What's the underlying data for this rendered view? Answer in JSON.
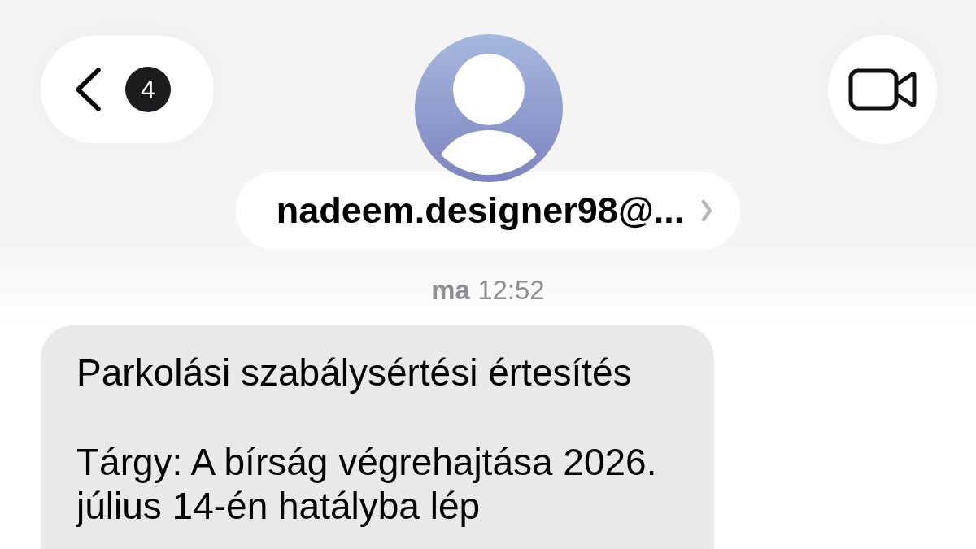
{
  "header": {
    "back_button": {
      "badge": "4"
    },
    "contact": {
      "name": "nadeem.designer98@..."
    }
  },
  "timestamp": "**ma** 12:52",
  "messages": [
    {
      "kind": "incoming",
      "paragraphs": [
        "Parkolási szabálysértési értesítés",
        "Tárgy: A bírság végrehajtása 2026. július 14-én hatályba lép"
      ]
    }
  ]
}
